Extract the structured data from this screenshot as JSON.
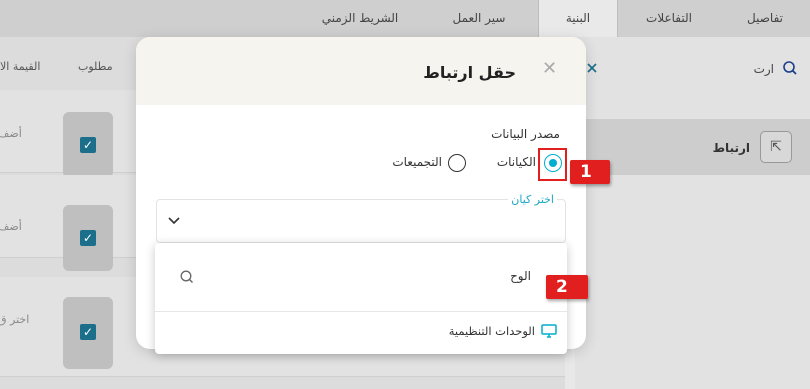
{
  "tabs": [
    {
      "label": "تفاصيل"
    },
    {
      "label": "التفاعلات"
    },
    {
      "label": "البنية"
    },
    {
      "label": "سير العمل"
    },
    {
      "label": "الشريط الزمني"
    }
  ],
  "table": {
    "headers": [
      "مطلوب",
      "القيمة الا"
    ],
    "row_placeholders": [
      "أضف",
      "أضف",
      "اختر ق"
    ]
  },
  "right_pane": {
    "search_value": "ارت",
    "item_label": "ارتباط"
  },
  "modal": {
    "title": "حقل ارتباط",
    "data_source_label": "مصدر البيانات",
    "radio_entities": "الكيانات",
    "radio_collections": "التجميعات",
    "select_label": "اختر كيان"
  },
  "dropdown": {
    "search_value": "الوح",
    "options": [
      {
        "label": "الوحدات التنظيمية",
        "icon": "monitor-icon"
      }
    ]
  },
  "callouts": [
    "1",
    "2"
  ],
  "colors": {
    "accent": "#00aecf",
    "callout_red": "#e11f1f",
    "checkbox": "#1b6f8a"
  }
}
